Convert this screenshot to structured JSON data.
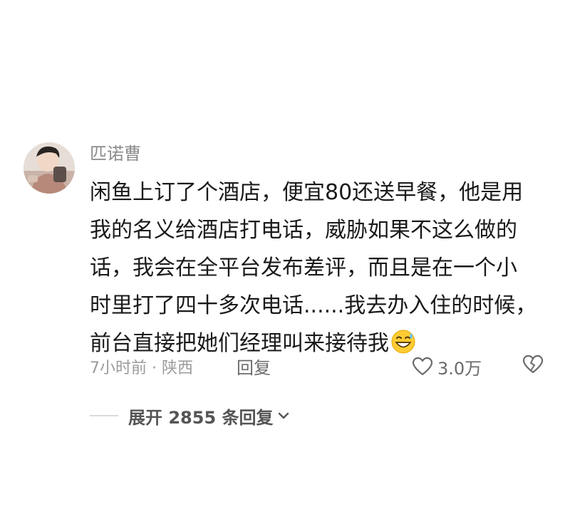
{
  "comment": {
    "username": "匹诺曹",
    "lines": [
      "闲鱼上订了个酒店，便宜80还送早餐，他是用",
      "我的名义给酒店打电话，威胁如果不这么做的",
      "话，我会在全平台发布差评，而且是在一个小",
      "时里打了四十多次电话......我去办入住的时候，",
      "前台直接把她们经理叫来接待我"
    ],
    "emoji": "grinning-sweat-emoji",
    "meta": {
      "time_location": "7小时前 · 陕西",
      "reply_label": "回复",
      "like_count": "3.0万"
    },
    "expand_label": "展开 2855 条回复"
  },
  "colors": {
    "username": "#8a8a8a",
    "body": "#1a1a1a",
    "meta": "#9a9a9a",
    "action": "#6b6b6b",
    "expand": "#555555"
  },
  "icons": {
    "avatar": "avatar",
    "like": "heart-outline-icon",
    "dislike": "broken-heart-icon",
    "expand": "chevron-down-icon"
  }
}
